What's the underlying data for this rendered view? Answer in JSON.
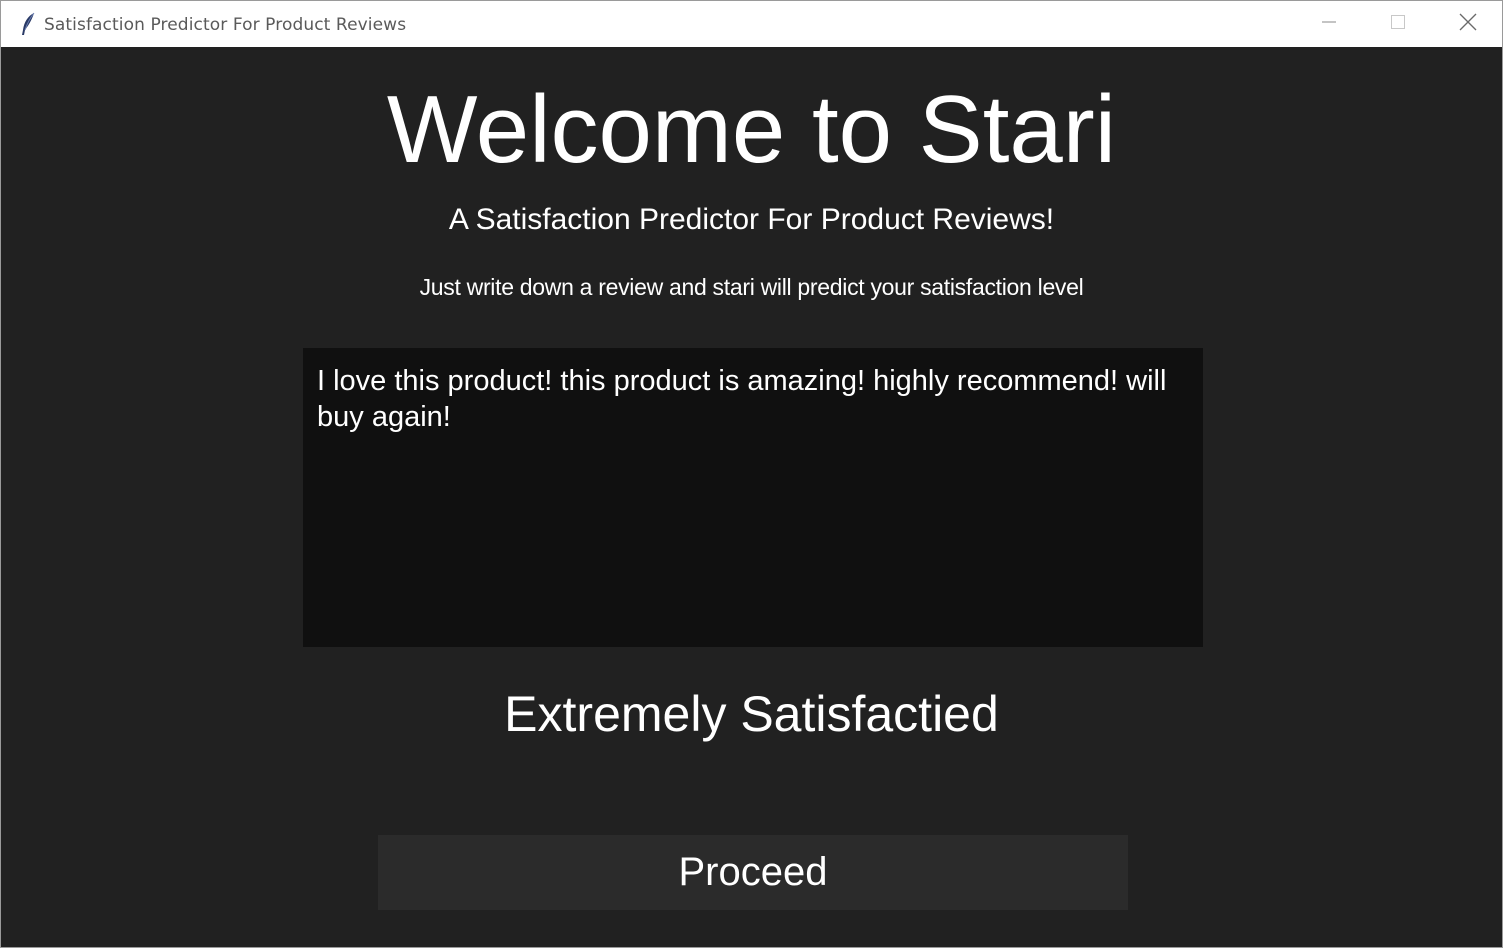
{
  "window": {
    "title": "Satisfaction Predictor For Product Reviews",
    "icon": "feather-icon",
    "controls": [
      "minimize-icon",
      "maximize-icon",
      "close-icon"
    ]
  },
  "main": {
    "heading": "Welcome to Stari",
    "subheading": "A Satisfaction Predictor For Product Reviews!",
    "instructions": "Just write down a review and stari will predict your satisfaction level",
    "review_text": "I love this product! this product is amazing! highly recommend! will buy again!",
    "result": "Extremely Satisfactied",
    "proceed_label": "Proceed"
  },
  "colors": {
    "background": "#212121",
    "textbox": "#101010",
    "button": "#2b2b2b",
    "text": "#ffffff"
  }
}
